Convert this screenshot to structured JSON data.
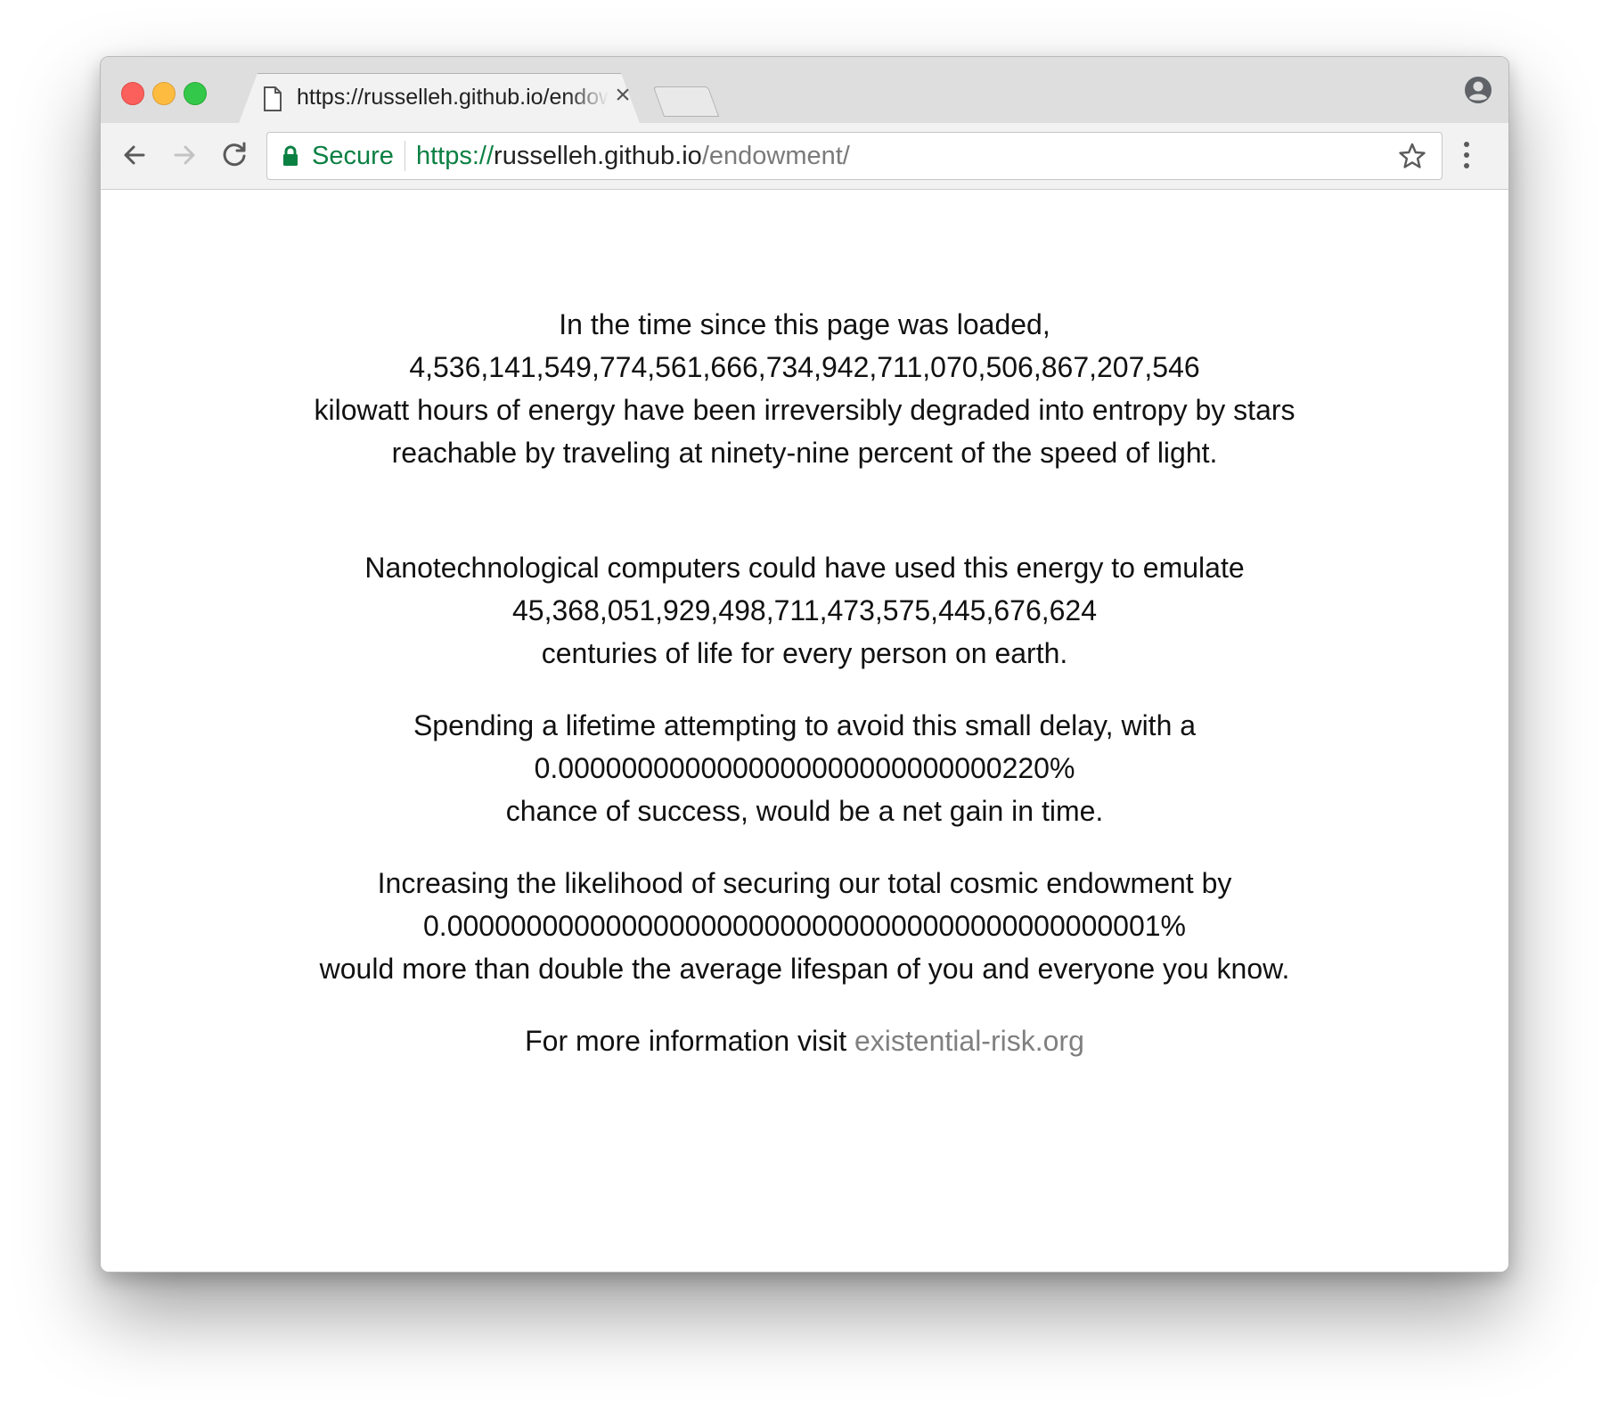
{
  "browser": {
    "tab": {
      "title": "https://russelleh.github.io/endowment/",
      "close_glyph": "×"
    },
    "omnibox": {
      "secure_label": "Secure",
      "url_scheme": "https://",
      "url_host": "russelleh.github.io",
      "url_path": "/endowment/"
    },
    "colors": {
      "secure_green": "#0b8043",
      "close_red": "#fc605c",
      "minimize_yellow": "#fdbc40",
      "zoom_green": "#34c84a"
    },
    "icons": [
      "document-icon",
      "close-icon",
      "profile-icon",
      "back-arrow-icon",
      "forward-arrow-icon",
      "reload-icon",
      "lock-icon",
      "star-icon",
      "more-vert-icon"
    ]
  },
  "page": {
    "entropy": {
      "line1": "In the time since this page was loaded,",
      "kwh_value": "4,536,141,549,774,561,666,734,942,711,070,506,867,207,546",
      "line3": "kilowatt hours of energy have been irreversibly degraded into entropy by stars",
      "line4": "reachable by traveling at ninety-nine percent of the speed of light."
    },
    "emulation": {
      "line1": "Nanotechnological computers could have used this energy to emulate",
      "centuries_value": "45,368,051,929,498,711,473,575,445,676,624",
      "line3": "centuries of life for every person on earth."
    },
    "lifetime": {
      "line1": "Spending a lifetime attempting to avoid this small delay, with a",
      "chance_value": "0.0000000000000000000000000000220%",
      "line3": "chance of success, would be a net gain in time."
    },
    "endowment": {
      "line1": "Increasing the likelihood of securing our total cosmic endowment by",
      "likelihood_value": "0.000000000000000000000000000000000000000000001%",
      "line3": "would more than double the average lifespan of you and everyone you know."
    },
    "more_info": {
      "prefix": "For more information visit",
      "link_text": "existential-risk.org"
    }
  }
}
